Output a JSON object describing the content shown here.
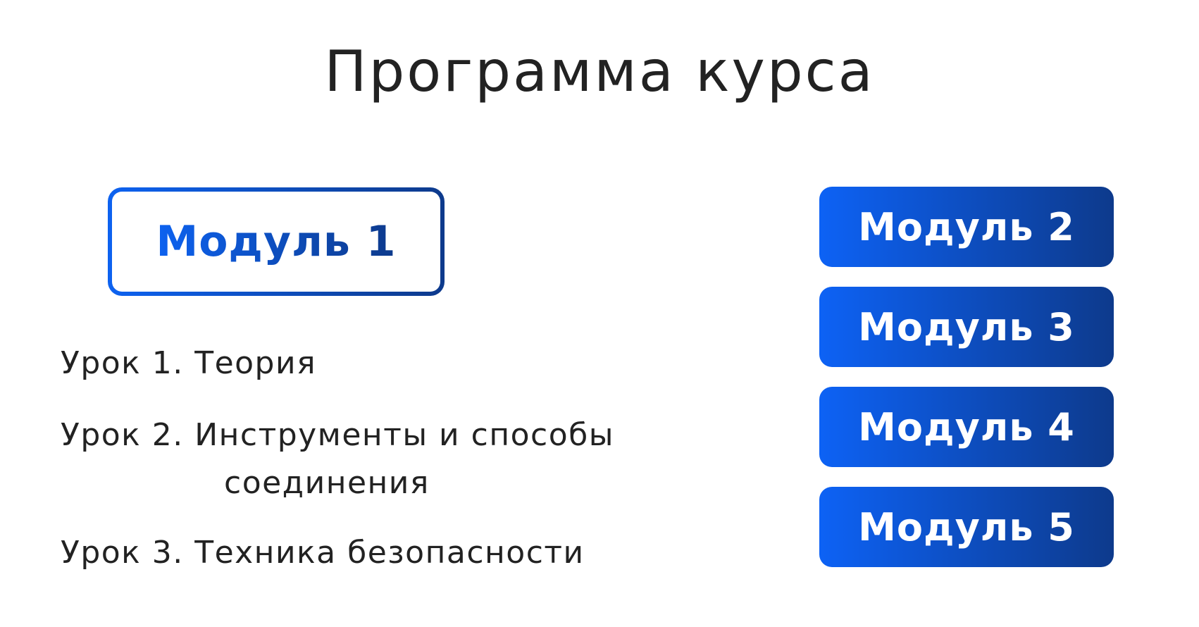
{
  "title": "Программа курса",
  "active_module": {
    "label": "Модуль 1"
  },
  "lessons": [
    {
      "label": "Урок 1. Теория"
    },
    {
      "label": "Урок 2. Инструменты и способы",
      "continuation": "соединения"
    },
    {
      "label": "Урок 3. Техника безопасности"
    }
  ],
  "other_modules": [
    {
      "label": "Модуль 2"
    },
    {
      "label": "Модуль 3"
    },
    {
      "label": "Модуль 4"
    },
    {
      "label": "Модуль 5"
    }
  ],
  "colors": {
    "gradient_start": "#0d62f0",
    "gradient_end": "#0d3a8c",
    "text": "#222222",
    "background": "#ffffff"
  }
}
